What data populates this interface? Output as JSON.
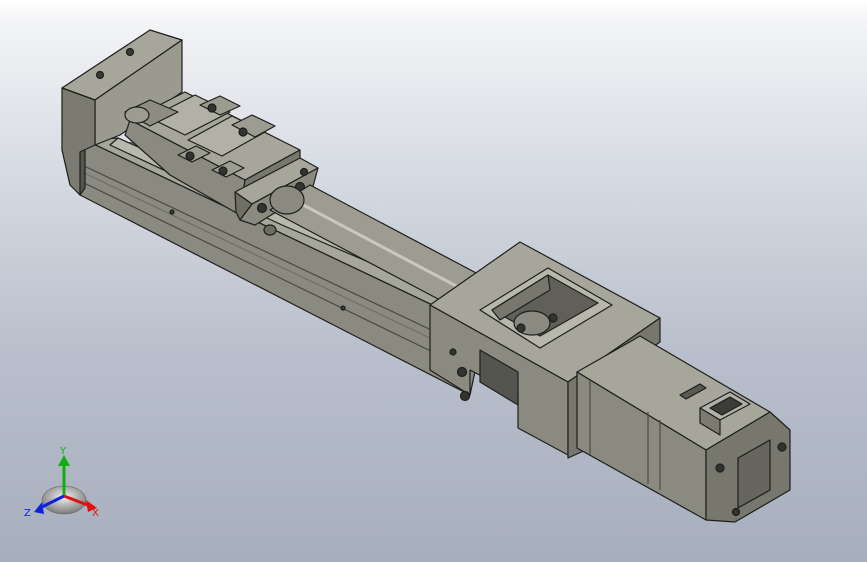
{
  "viewport": {
    "background_top": "#ffffff",
    "background_bottom": "#a7aebd"
  },
  "model": {
    "body_color": "#8a8a80",
    "body_light": "#a6a69b",
    "body_dark": "#55554e",
    "edge_color": "#1e1e1c"
  },
  "triad": {
    "x_label": "X",
    "y_label": "Y",
    "z_label": "Z",
    "x_color": "#e01010",
    "y_color": "#10b010",
    "z_color": "#1020e0"
  }
}
